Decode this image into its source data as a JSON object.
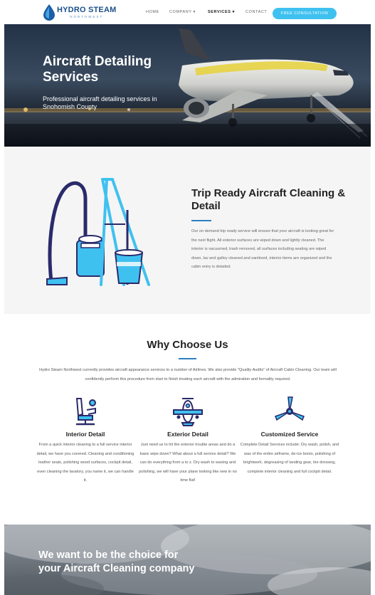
{
  "header": {
    "logo_main": "HYDRO STEAM",
    "logo_sub": "NORTHWEST",
    "nav": [
      {
        "label": "HOME"
      },
      {
        "label": "COMPANY ▾"
      },
      {
        "label": "SERVICES ▾"
      },
      {
        "label": "CONTACT"
      }
    ],
    "cta_label": "FREE CONSULTATION"
  },
  "hero": {
    "title": "Aircraft Detailing Services",
    "subtitle": "Professional aircraft detailing services in Snohomish County"
  },
  "trip": {
    "title": "Trip Ready Aircraft Cleaning & Detail",
    "body": "Our on demand trip ready service will ensure that your aircraft is looking great for the next flight. All exterior surfaces are wiped down and lightly cleaned. The interior is vacuumed, trash removed, all surfaces including seating are wiped down, lav and galley cleaned and sanitized, interior items are organized and the cabin entry is detailed."
  },
  "why": {
    "title": "Why Choose Us",
    "intro": "Hydro Steam Northwest currently provides aircraft appearance services to a number of Airlines. We also provide \"Quality Audits\" of Aircraft Cabin Cleaning. Our team will confidently perform this procedure from start to finish treating each aircraft with the admiration and formality required.",
    "features": [
      {
        "title": "Interior Detail",
        "icon": "seat-icon",
        "text": "From a quick interior cleaning to a full service interior detail, we have you covered. Cleaning and conditioning leather seats, polishing wood surfaces, cockpit detail, even cleaning the lavatory, you name it, we can handle it."
      },
      {
        "title": "Exterior Detail",
        "icon": "airplane-icon",
        "text": "Just need us to hit the exterior trouble areas and do a basic wipe down? What about a full service detail? We can do everything from a to z. Dry wash to waxing and polishing, we will have your plane looking like new in no time flat!"
      },
      {
        "title": "Customized Service",
        "icon": "propeller-icon",
        "text": "Complete Detail Services include: Dry wash, polish, and wax of the entire airframe, de-ice boots, polishing of brightwork, degreasing of landing gear, tire dressing, complete interior cleaning and full cockpit detail."
      }
    ]
  },
  "banner": {
    "title": "We want to be the choice for your Aircraft Cleaning company"
  },
  "colors": {
    "accent": "#3fc1f0",
    "brand": "#1b4f8a",
    "rule": "#2d7fc1",
    "illustration_dark": "#2b2a6b"
  }
}
